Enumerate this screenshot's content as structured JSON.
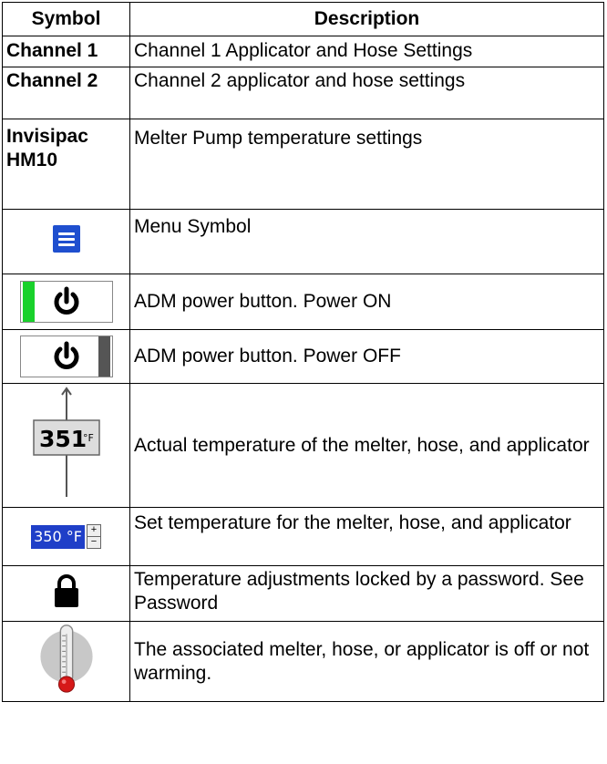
{
  "headers": {
    "symbol": "Symbol",
    "description": "Description"
  },
  "rows": [
    {
      "symbol": "Channel 1",
      "description": "Channel 1 Applicator and Hose Settings"
    },
    {
      "symbol": "Channel 2",
      "description": "Channel 2 applicator and hose settings"
    },
    {
      "symbol": "Invisipac HM10",
      "description": "Melter Pump temperature settings"
    },
    {
      "symbol_icon": "menu-icon",
      "description": "Menu Symbol"
    },
    {
      "symbol_icon": "power-on-icon",
      "description": "ADM power button. Power ON"
    },
    {
      "symbol_icon": "power-off-icon",
      "description": "ADM power button. Power OFF"
    },
    {
      "symbol_icon": "actual-temperature-icon",
      "symbol_value": "351",
      "symbol_unit": "°F",
      "description": "Actual temperature of the melter, hose, and applicator"
    },
    {
      "symbol_icon": "set-temperature-icon",
      "symbol_value": "350 °F",
      "description": "Set temperature for the melter, hose, and applicator"
    },
    {
      "symbol_icon": "lock-icon",
      "description": "Temperature adjustments locked by a password. See Password"
    },
    {
      "symbol_icon": "thermometer-off-icon",
      "description": "The associated melter, hose, or applicator is off or not warming."
    }
  ],
  "colors": {
    "menu_blue": "#1f4fcf",
    "power_on_green": "#19d12b",
    "power_off_gray": "#555555",
    "set_temp_blue": "#1f3fc8",
    "thermometer_red": "#d61818",
    "thermometer_bg": "#c8c8c8"
  }
}
